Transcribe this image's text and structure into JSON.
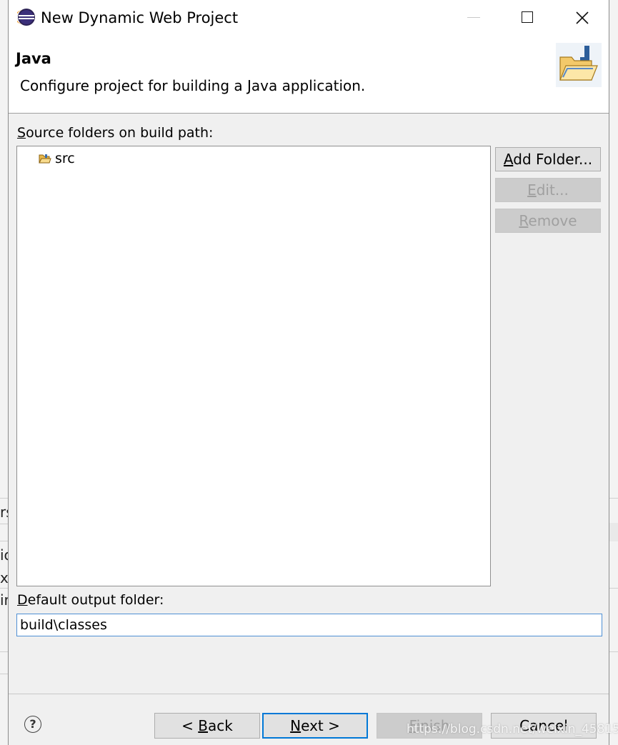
{
  "window": {
    "title": "New Dynamic Web Project"
  },
  "header": {
    "title": "Java",
    "description": "Configure project for building a Java application."
  },
  "source_folders": {
    "label_mnemonic": "S",
    "label_rest": "ource folders on build path:",
    "items": [
      {
        "label": "src",
        "icon": "source-folder-icon"
      }
    ]
  },
  "side_buttons": {
    "add_folder": {
      "mnemonic": "A",
      "rest": "dd Folder...",
      "enabled": true
    },
    "edit": {
      "mnemonic": "E",
      "rest": "dit...",
      "enabled": false
    },
    "remove": {
      "mnemonic": "R",
      "rest": "emove",
      "enabled": false
    }
  },
  "output": {
    "label_mnemonic": "D",
    "label_rest": "efault output folder:",
    "value": "build\\classes"
  },
  "footer": {
    "help_glyph": "?",
    "back": {
      "prefix": "< ",
      "mnemonic": "B",
      "rest": "ack",
      "enabled": true
    },
    "next": {
      "mnemonic": "N",
      "rest": "ext >",
      "enabled": true
    },
    "finish": {
      "mnemonic": "F",
      "rest": "inish",
      "enabled": false
    },
    "cancel": {
      "label": "Cancel",
      "enabled": true
    }
  },
  "background": {
    "left_chars": [
      "rs",
      "ic",
      "x",
      "ir"
    ]
  },
  "watermark": "https://blog.csdn.net/weixin_45815061",
  "colors": {
    "dialog_bg": "#f0f0f0",
    "focus_border": "#0078d7",
    "input_border": "#4f8fd4",
    "disabled_text": "#a0a0a0"
  }
}
